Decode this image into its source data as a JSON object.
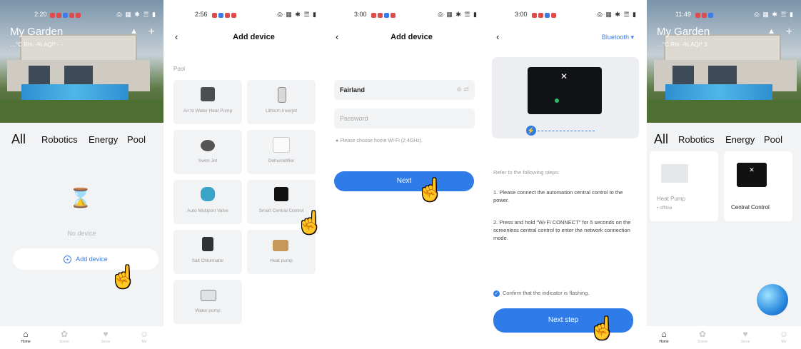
{
  "screen1": {
    "status_time": "2:20",
    "hero_title": "My Garden",
    "hero_sub": "…°C  RH- -%  AQI* - -",
    "tabs": [
      "All",
      "Robotics",
      "Energy",
      "Pool"
    ],
    "empty_text": "No device",
    "add_device": "Add device",
    "tabbar": [
      "Home",
      "Scene",
      "Serve",
      "Me"
    ]
  },
  "screen2": {
    "status_time": "2:56",
    "title": "Add device",
    "section": "Pool",
    "cards": [
      "Air to Water Heat Pump",
      "Lithium Inverjet",
      "Swim Jet",
      "Dehumidifier",
      "Auto Multiport Valve",
      "Smart Central Control",
      "Salt Chlorinator",
      "Heat pump",
      "Water pump"
    ]
  },
  "screen3": {
    "status_time": "3:00",
    "title": "Add device",
    "ssid_value": "Fairland",
    "password_placeholder": "Password",
    "hint": "Please choose home Wi-Fi (2.4GHz).",
    "next": "Next"
  },
  "screen4": {
    "status_time": "3:00",
    "mode": "Bluetooth",
    "intro": "Refer to the following steps:",
    "step1": "1. Please connect the automation central control to the power.",
    "step2": "2. Press and hold \"Wi-Fi CONNECT\" for 5 seconds on the screenless central control to enter the network connection mode.",
    "confirm": "Confirm that the indicator is flashing.",
    "next_step": "Next step"
  },
  "screen5": {
    "status_time": "11:49",
    "hero_title": "My Garden",
    "hero_sub": "…°C  RH- -%  AQI* 3",
    "tabs": [
      "All",
      "Robotics",
      "Energy",
      "Pool"
    ],
    "device1_name": "Heat Pump",
    "device1_status": "offline",
    "device2_name": "Central Control",
    "tabbar": [
      "Home",
      "Scene",
      "Serve",
      "Me"
    ]
  },
  "colors": {
    "accent": "#2f7be8",
    "brand_accent": "#3d7ce8"
  },
  "icons": [
    "back-arrow-icon",
    "plus-icon",
    "pointer-hand-icon",
    "wifi-icon",
    "check-icon",
    "home-icon",
    "scene-icon",
    "serve-icon",
    "me-icon",
    "assistant-orb-icon"
  ]
}
